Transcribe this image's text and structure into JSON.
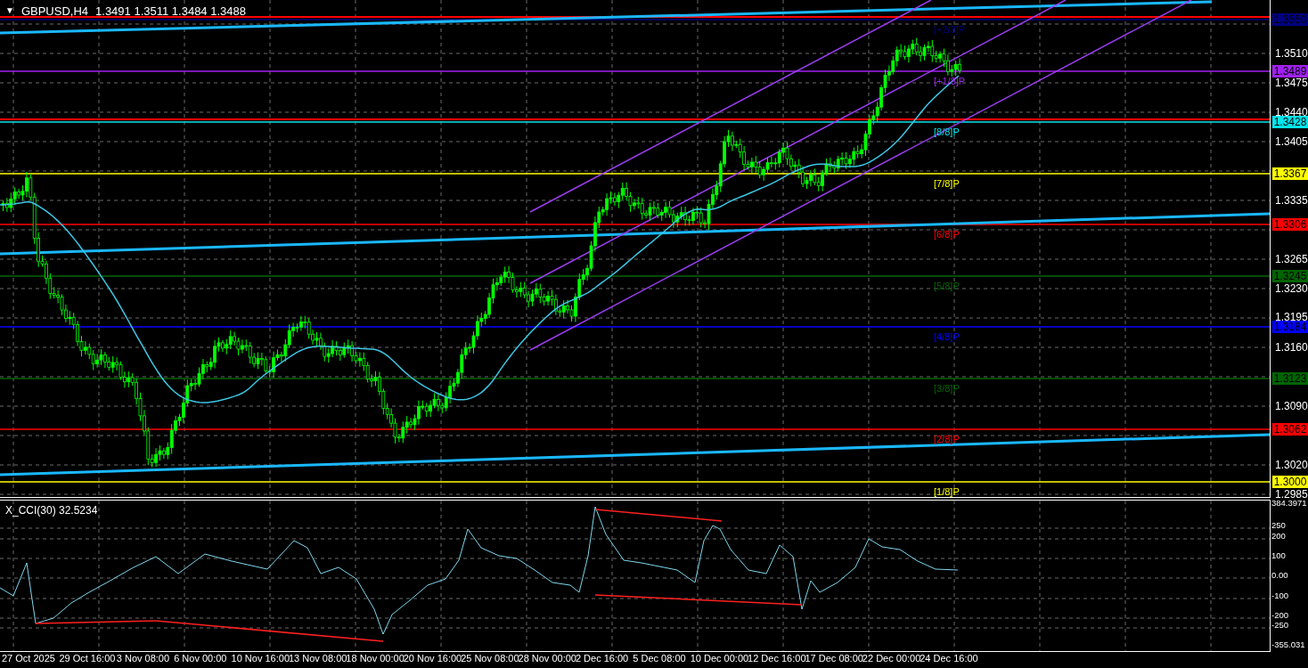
{
  "chart": {
    "toggle_glyph": "▼",
    "title": "GBPUSD,H4",
    "ohlc": "1.3491 1.3511 1.3484 1.3488",
    "price_ticks": [
      "1.3510",
      "1.3475",
      "1.3440",
      "1.3405",
      "1.3335",
      "1.3265",
      "1.3230",
      "1.3195",
      "1.3160",
      "1.3090",
      "1.3020",
      "1.2985"
    ],
    "levels": [
      {
        "price": "1.3550",
        "label": "[+2/8]P",
        "color": "#000080"
      },
      {
        "price": "1.3489",
        "label": "[+1/8]P",
        "color": "#a020f0"
      },
      {
        "price": "1.3428",
        "label": "[8/8]P",
        "color": "#00e5ee"
      },
      {
        "price": "1.3367",
        "label": "[7/8]P",
        "color": "#ffff00"
      },
      {
        "price": "1.3306",
        "label": "[6/8]P",
        "color": "#ff0000"
      },
      {
        "price": "1.3245",
        "label": "[5/8]P",
        "color": "#006400"
      },
      {
        "price": "1.3184",
        "label": "[4/8]P",
        "color": "#0000ff"
      },
      {
        "price": "1.3123",
        "label": "[3/8]P",
        "color": "#006400"
      },
      {
        "price": "1.3062",
        "label": "[2/8]P",
        "color": "#ff0000"
      },
      {
        "price": "1.3000",
        "label": "[1/8]P",
        "color": "#ffff00"
      }
    ]
  },
  "indicator": {
    "title": "X_CCI(30) 32.5234",
    "ticks": [
      "384.3971",
      "250",
      "200",
      "100",
      "0.00",
      "-100",
      "-200",
      "-250",
      "-355.031"
    ]
  },
  "time_axis": [
    "27 Oct 2025",
    "29 Oct 16:00",
    "3 Nov 08:00",
    "6 Nov 00:00",
    "10 Nov 16:00",
    "13 Nov 08:00",
    "18 Nov 00:00",
    "20 Nov 16:00",
    "25 Nov 08:00",
    "28 Nov 00:00",
    "2 Dec 16:00",
    "5 Dec 08:00",
    "10 Dec 00:00",
    "12 Dec 16:00",
    "17 Dec 08:00",
    "22 Dec 00:00",
    "24 Dec 16:00"
  ]
}
